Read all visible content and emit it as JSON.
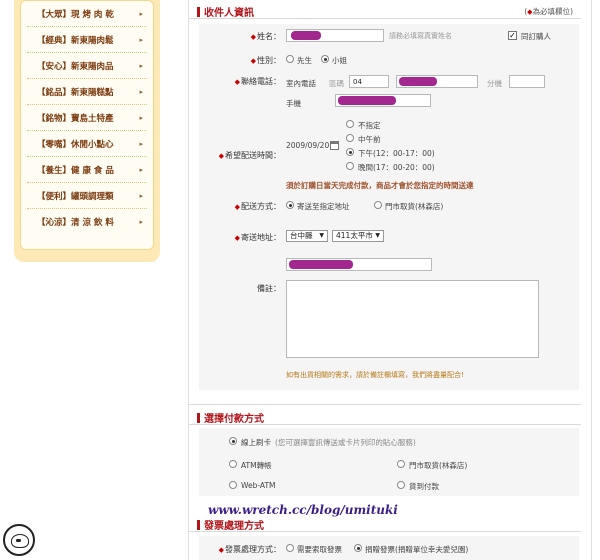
{
  "sidebar": {
    "items": [
      {
        "label": "【大眾】現 烤 肉 乾"
      },
      {
        "label": "【經典】新東陽肉鬆"
      },
      {
        "label": "【安心】新東陽肉品"
      },
      {
        "label": "【銘品】新東陽糕點"
      },
      {
        "label": "【銘物】寶島土特產"
      },
      {
        "label": "【零嘴】休閒小點心"
      },
      {
        "label": "【養生】健 康 食 品"
      },
      {
        "label": "【便利】罐頭調理類"
      },
      {
        "label": "【沁涼】清 涼 飲 料"
      }
    ],
    "arrow": "▸"
  },
  "recipient": {
    "title": "收件人資訊",
    "required_note": "為必填欄位",
    "required_mark": "◆",
    "name_label": "姓名：",
    "name_placeholder": "請務必填寫真實姓名",
    "same_as_buyer": "同訂購人",
    "gender_label": "性別：",
    "gender_male": "先生",
    "gender_female": "小姐",
    "phone_label": "聯絡電話：",
    "home_phone": "室內電話",
    "area_code_label": "區碼",
    "area_code_value": "04",
    "extension_label": "分機",
    "mobile_label": "手機",
    "time_label": "希望配送時間：",
    "date_value": "2009/09/20",
    "time_options": [
      "不指定",
      "中午前",
      "下午(12：00-17：00)",
      "晚間(17：00-20：00)"
    ],
    "warning": "須於訂購日當天完成付款，商品才會於您指定的時間送達",
    "delivery_label": "配送方式：",
    "delivery_home": "寄送至指定地址",
    "delivery_store": "門市取貨(林森店)",
    "address_label": "寄送地址：",
    "city": "台中縣",
    "district": "411太平市",
    "remarks_label": "備註：",
    "remarks_note": "如有出貨相關的需求，請於備註欄填寫，我們將盡量配合!"
  },
  "payment": {
    "title": "選擇付款方式",
    "credit_card": "線上刷卡",
    "credit_card_note": "(您可選擇豐訊傳送或卡片列印的貼心服務)",
    "atm": "ATM轉帳",
    "store_pickup": "門市取貨(林森店)",
    "web_atm": "Web-ATM",
    "cod": "貨到付款"
  },
  "invoice": {
    "title": "發票處理方式",
    "label": "發票處理方式：",
    "request": "需要索取發票",
    "donate": "捐贈發票(捐贈單位幸夫愛兒園)"
  },
  "watermark": "www.wretch.cc/blog/umituki"
}
